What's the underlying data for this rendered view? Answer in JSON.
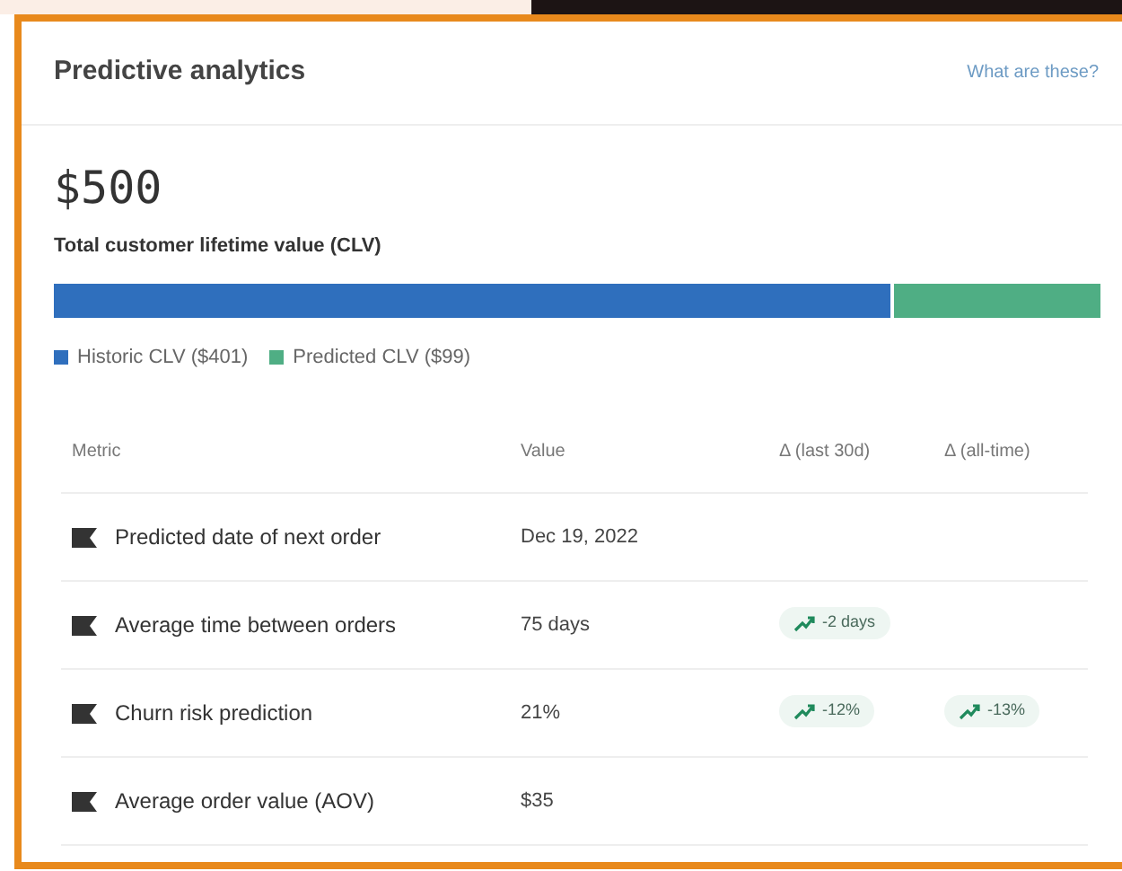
{
  "card": {
    "title": "Predictive analytics",
    "help_link": "What are these?"
  },
  "clv": {
    "total": "$500",
    "label": "Total customer lifetime value (CLV)",
    "segments": [
      {
        "label": "Historic CLV ($401)",
        "color": "#2f6fbd",
        "level": 0.802
      },
      {
        "label": "Predicted CLV ($99)",
        "color": "#4fae84"
      }
    ]
  },
  "table": {
    "columns": [
      "Metric",
      "Value",
      "Δ (last 30d)",
      "Δ (all-time)"
    ],
    "rows": [
      {
        "metric": "Predicted date of next order",
        "value": "Dec 19, 2022",
        "delta_30d": null,
        "delta_all_time": null
      },
      {
        "metric": "Average time between orders",
        "value": "75 days",
        "delta_30d": "-2 days",
        "delta_all_time": null
      },
      {
        "metric": "Churn risk prediction",
        "value": "21%",
        "delta_30d": "-12%",
        "delta_all_time": "-13%"
      },
      {
        "metric": "Average order value (AOV)",
        "value": "$35",
        "delta_30d": null,
        "delta_all_time": null
      }
    ]
  }
}
